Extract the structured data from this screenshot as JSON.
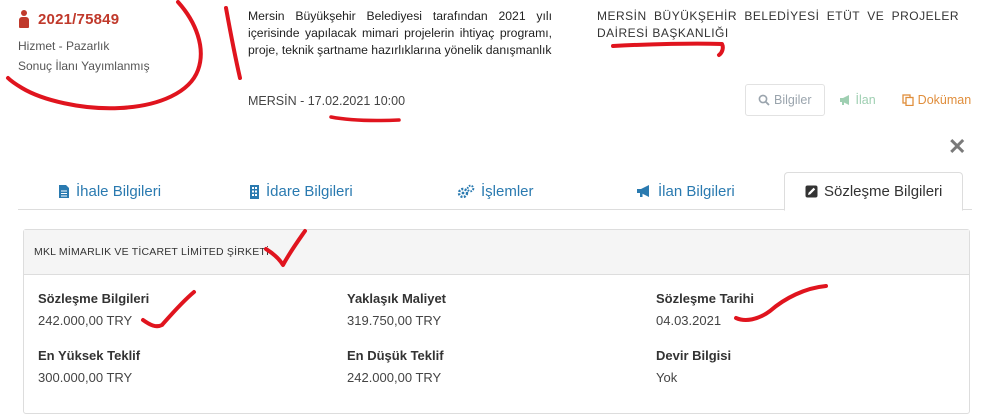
{
  "tender": {
    "number": "2021/75849",
    "type": "Hizmet - Pazarlık",
    "status": "Sonuç İlanı Yayımlanmış",
    "description": "Mersin Büyükşehir Belediyesi tarafından 2021 yılı içerisinde yapılacak mimari projelerin ihtiyaç programı, proje, teknik şartname hazırlıklarına yönelik danışmanlık",
    "place_date": "MERSİN - 17.02.2021 10:00",
    "authority": "MERSİN BÜYÜKŞEHİR BELEDİYESİ ETÜT VE PROJELER DAİRESİ BAŞKANLIĞI"
  },
  "header_actions": {
    "bilgiler": "Bilgiler",
    "ilan": "İlan",
    "dokuman": "Doküman"
  },
  "close_label": "✕",
  "tabs": [
    {
      "label": "İhale Bilgileri",
      "icon": "file-icon"
    },
    {
      "label": "İdare Bilgileri",
      "icon": "building-icon"
    },
    {
      "label": "İşlemler",
      "icon": "gears-icon"
    },
    {
      "label": "İlan Bilgileri",
      "icon": "bullhorn-icon"
    },
    {
      "label": "Sözleşme Bilgileri",
      "icon": "edit-icon",
      "active": true
    }
  ],
  "contract": {
    "company": "MKL MİMARLIK VE TİCARET LİMİTED ŞİRKETİ",
    "fields": {
      "contract_info": {
        "label": "Sözleşme Bilgileri",
        "value": "242.000,00 TRY"
      },
      "approx_cost": {
        "label": "Yaklaşık Maliyet",
        "value": "319.750,00 TRY"
      },
      "contract_date": {
        "label": "Sözleşme Tarihi",
        "value": "04.03.2021"
      },
      "highest_bid": {
        "label": "En Yüksek Teklif",
        "value": "300.000,00 TRY"
      },
      "lowest_bid": {
        "label": "En Düşük Teklif",
        "value": "242.000,00 TRY"
      },
      "transfer_info": {
        "label": "Devir Bilgisi",
        "value": "Yok"
      }
    }
  },
  "colors": {
    "accent_red": "#c0392b",
    "link_blue": "#2a7ab0",
    "annotation_red": "#e0141e",
    "ilan_green": "#9fcfb2",
    "dokuman_orange": "#e08e3c"
  }
}
